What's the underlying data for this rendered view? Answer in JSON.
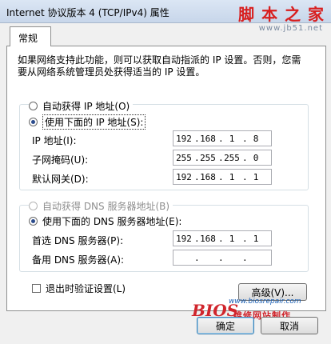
{
  "window": {
    "title": "Internet 协议版本 4 (TCP/IPv4) 属性"
  },
  "watermark": {
    "site_cn": "脚 本 之 家",
    "site_url": "www.jb51.net"
  },
  "tabs": [
    {
      "label": "常规"
    }
  ],
  "description": "如果网络支持此功能，则可以获取自动指派的 IP 设置。否则，您需要从网络系统管理员处获得适当的 IP 设置。",
  "ip": {
    "auto_label": "自动获得 IP 地址(O)",
    "manual_label": "使用下面的 IP 地址(S):",
    "selected": "manual",
    "fields": [
      {
        "label": "IP 地址(I):",
        "octets": [
          "192",
          "168",
          "1",
          "8"
        ]
      },
      {
        "label": "子网掩码(U):",
        "octets": [
          "255",
          "255",
          "255",
          "0"
        ]
      },
      {
        "label": "默认网关(D):",
        "octets": [
          "192",
          "168",
          "1",
          "1"
        ]
      }
    ]
  },
  "dns": {
    "auto_label": "自动获得 DNS 服务器地址(B)",
    "manual_label": "使用下面的 DNS 服务器地址(E):",
    "selected": "manual",
    "fields": [
      {
        "label": "首选 DNS 服务器(P):",
        "octets": [
          "192",
          "168",
          "1",
          "1"
        ]
      },
      {
        "label": "备用 DNS 服务器(A):",
        "octets": [
          "",
          "",
          "",
          ""
        ]
      }
    ]
  },
  "validate_label": "退出时验证设置(L)",
  "validate_checked": false,
  "buttons": {
    "advanced": "高级(V)...",
    "ok": "确定",
    "cancel": "取消"
  },
  "bios_watermark": {
    "url": "www.biosrepair.com",
    "logo": "BIOS",
    "cn": "维修网站制作"
  }
}
